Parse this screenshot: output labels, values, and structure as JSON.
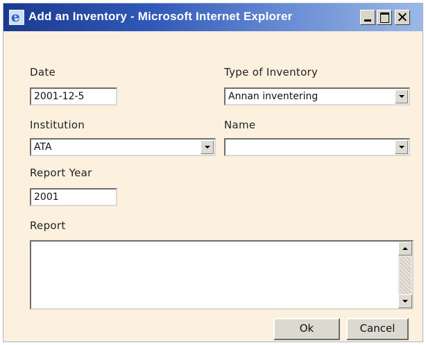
{
  "window": {
    "title": "Add an Inventory - Microsoft Internet Explorer"
  },
  "form": {
    "date_label": "Date",
    "date_value": "2001-12-5",
    "type_label": "Type of Inventory",
    "type_value": "Annan inventering",
    "institution_label": "Institution",
    "institution_value": "ATA",
    "name_label": "Name",
    "name_value": "",
    "report_year_label": "Report Year",
    "report_year_value": "2001",
    "report_label": "Report",
    "report_value": ""
  },
  "buttons": {
    "ok_label": "Ok",
    "cancel_label": "Cancel"
  },
  "icons": {
    "title_icon": "ie-document-icon",
    "minimize": "minimize-icon",
    "maximize": "maximize-icon",
    "close": "close-icon"
  },
  "colors": {
    "dialog_background": "#fcf0de",
    "titlebar_start": "#1a3a8e",
    "titlebar_end": "#9cb8e6"
  }
}
